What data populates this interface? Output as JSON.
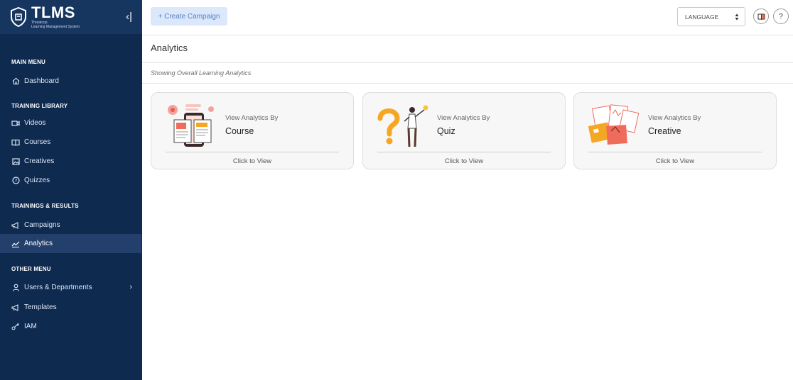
{
  "app": {
    "brand_title": "TLMS",
    "brand_subtitle_1": "Threatcop",
    "brand_subtitle_2": "Learning Management System"
  },
  "sidebar": {
    "sections": [
      {
        "heading": "MAIN MENU",
        "items": [
          {
            "label": "Dashboard",
            "icon": "home-icon"
          }
        ]
      },
      {
        "heading": "TRAINING LIBRARY",
        "items": [
          {
            "label": "Videos",
            "icon": "video-icon"
          },
          {
            "label": "Courses",
            "icon": "book-icon"
          },
          {
            "label": "Creatives",
            "icon": "image-icon"
          },
          {
            "label": "Quizzes",
            "icon": "question-icon"
          }
        ]
      },
      {
        "heading": "TRAININGS & RESULTS",
        "items": [
          {
            "label": "Campaigns",
            "icon": "megaphone-icon"
          },
          {
            "label": "Analytics",
            "icon": "chart-line-icon",
            "active": true
          }
        ]
      },
      {
        "heading": "OTHER MENU",
        "items": [
          {
            "label": "Users & Departments",
            "icon": "user-icon",
            "has_submenu": true
          },
          {
            "label": "Templates",
            "icon": "megaphone-icon"
          },
          {
            "label": "IAM",
            "icon": "key-icon"
          }
        ]
      }
    ]
  },
  "topbar": {
    "create_label": "+ Create Campaign",
    "language_label": "LANGUAGE",
    "help_label": "?"
  },
  "page": {
    "title": "Analytics",
    "subtitle": "Showing Overall Learning Analytics"
  },
  "cards": [
    {
      "kicker": "View Analytics By",
      "name": "Course",
      "link": "Click to View",
      "illustration": "course-illustration"
    },
    {
      "kicker": "View Analytics By",
      "name": "Quiz",
      "link": "Click to View",
      "illustration": "quiz-illustration"
    },
    {
      "kicker": "View Analytics By",
      "name": "Creative",
      "link": "Click to View",
      "illustration": "creative-illustration"
    }
  ],
  "colors": {
    "sidebar_bg": "#0f2a4f",
    "sidebar_active": "#22406b",
    "accent_orange": "#f5a623",
    "accent_red": "#ef6b5b",
    "create_button_bg": "#dbe8fb"
  }
}
